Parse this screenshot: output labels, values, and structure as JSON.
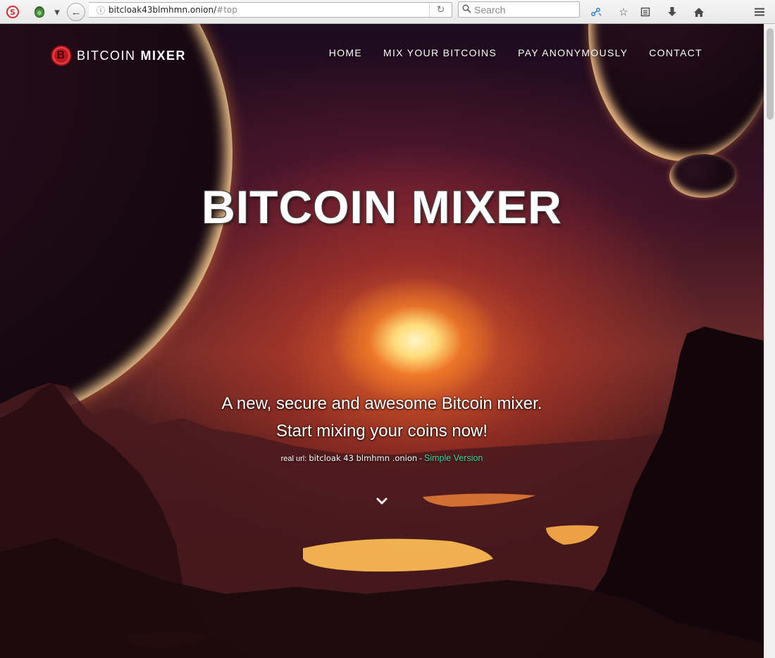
{
  "browser": {
    "url_main": "bitcloak43blmhmn.onion/",
    "url_fragment": "#top",
    "search_placeholder": "Search",
    "icons": {
      "noscript": "noscript-icon",
      "tor": "tor-onion-icon",
      "back": "back-arrow-icon",
      "info": "info-icon",
      "reload": "reload-icon",
      "search": "search-icon",
      "extension": "extension-icon",
      "bookmark": "star-icon",
      "reader": "reading-list-icon",
      "downloads": "download-icon",
      "home": "home-icon",
      "menu": "hamburger-menu-icon"
    }
  },
  "site": {
    "logo_word1": "BITCOIN",
    "logo_word2": "MIXER",
    "coin_symbol": "B",
    "nav": [
      {
        "label": "HOME"
      },
      {
        "label": "MIX YOUR BITCOINS"
      },
      {
        "label": "PAY ANONYMOUSLY"
      },
      {
        "label": "CONTACT"
      }
    ]
  },
  "hero": {
    "title": "BITCOIN MIXER",
    "subtitle_line1": "A new, secure and awesome Bitcoin mixer.",
    "subtitle_line2": "Start mixing your coins now!",
    "real_url_label": "real url:",
    "real_url_value": "bitcloak 43 blmhmn .onion",
    "separator": "-",
    "simple_version_link": "Simple Version"
  },
  "colors": {
    "logo_coin": "#c0161f",
    "simple_link": "#45d2a0"
  }
}
